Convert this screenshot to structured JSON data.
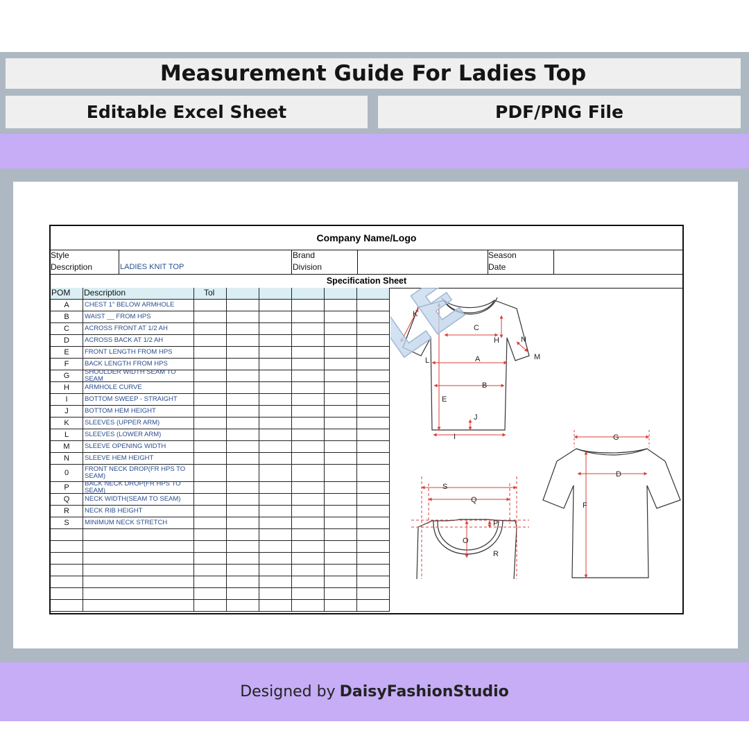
{
  "banner": {
    "title": "Measurement Guide For Ladies Top",
    "left_label": "Editable Excel Sheet",
    "right_label": "PDF/PNG File"
  },
  "sheet": {
    "company": "Company Name/Logo",
    "style_label_1": "Style",
    "style_label_2": "Description",
    "style_value": "LADIES KNIT TOP",
    "brand_label": "Brand",
    "division_label": "Division",
    "season_label": "Season",
    "date_label": "Date",
    "spec_title": "Specification Sheet",
    "headers": {
      "pom": "POM",
      "description": "Description",
      "tol": "Tol"
    },
    "rows": [
      {
        "pom": "A",
        "desc": "CHEST 1\" BELOW ARMHOLE"
      },
      {
        "pom": "B",
        "desc": "WAIST __  FROM HPS"
      },
      {
        "pom": "C",
        "desc": "ACROSS FRONT AT 1/2 AH"
      },
      {
        "pom": "D",
        "desc": "ACROSS BACK AT 1/2 AH"
      },
      {
        "pom": "E",
        "desc": "FRONT LENGTH FROM HPS"
      },
      {
        "pom": "F",
        "desc": "BACK LENGTH FROM HPS"
      },
      {
        "pom": "G",
        "desc": "SHOULDER WIDTH SEAM TO SEAM"
      },
      {
        "pom": "H",
        "desc": "ARMHOLE CURVE"
      },
      {
        "pom": "I",
        "desc": "BOTTOM SWEEP - STRAIGHT"
      },
      {
        "pom": "J",
        "desc": "BOTTOM HEM HEIGHT"
      },
      {
        "pom": "K",
        "desc": "SLEEVES (UPPER ARM)"
      },
      {
        "pom": "L",
        "desc": "SLEEVES (LOWER ARM)"
      },
      {
        "pom": "M",
        "desc": "SLEEVE OPENING WIDTH"
      },
      {
        "pom": "N",
        "desc": "SLEEVE HEM HEIGHT"
      },
      {
        "pom": "0",
        "desc": "FRONT NECK DROP(FR HPS TO SEAM)"
      },
      {
        "pom": "P",
        "desc": "BACK NECK DROP(FR HPS TO SEAM)"
      },
      {
        "pom": "Q",
        "desc": "NECK WIDTH(SEAM TO SEAM)"
      },
      {
        "pom": "R",
        "desc": "NECK RIB HEIGHT"
      },
      {
        "pom": "S",
        "desc": "MINIMUM NECK STRETCH"
      }
    ],
    "blank_rows": 7,
    "watermark": "SAMPLE",
    "sketch_labels": {
      "front": [
        "K",
        "C",
        "H",
        "N",
        "M",
        "L",
        "A",
        "B",
        "E",
        "J",
        "I"
      ],
      "back": [
        "G",
        "D",
        "F"
      ],
      "neck": [
        "S",
        "Q",
        "P",
        "O",
        "R"
      ]
    }
  },
  "footer": {
    "prefix": "Designed by",
    "brand": "DaisyFashionStudio"
  },
  "colors": {
    "lavender": "#c6adf6",
    "frame": "#adb8c2",
    "header_fill": "#daeef3",
    "measure_red": "#d9403a",
    "desc_blue": "#2a4d8f"
  }
}
